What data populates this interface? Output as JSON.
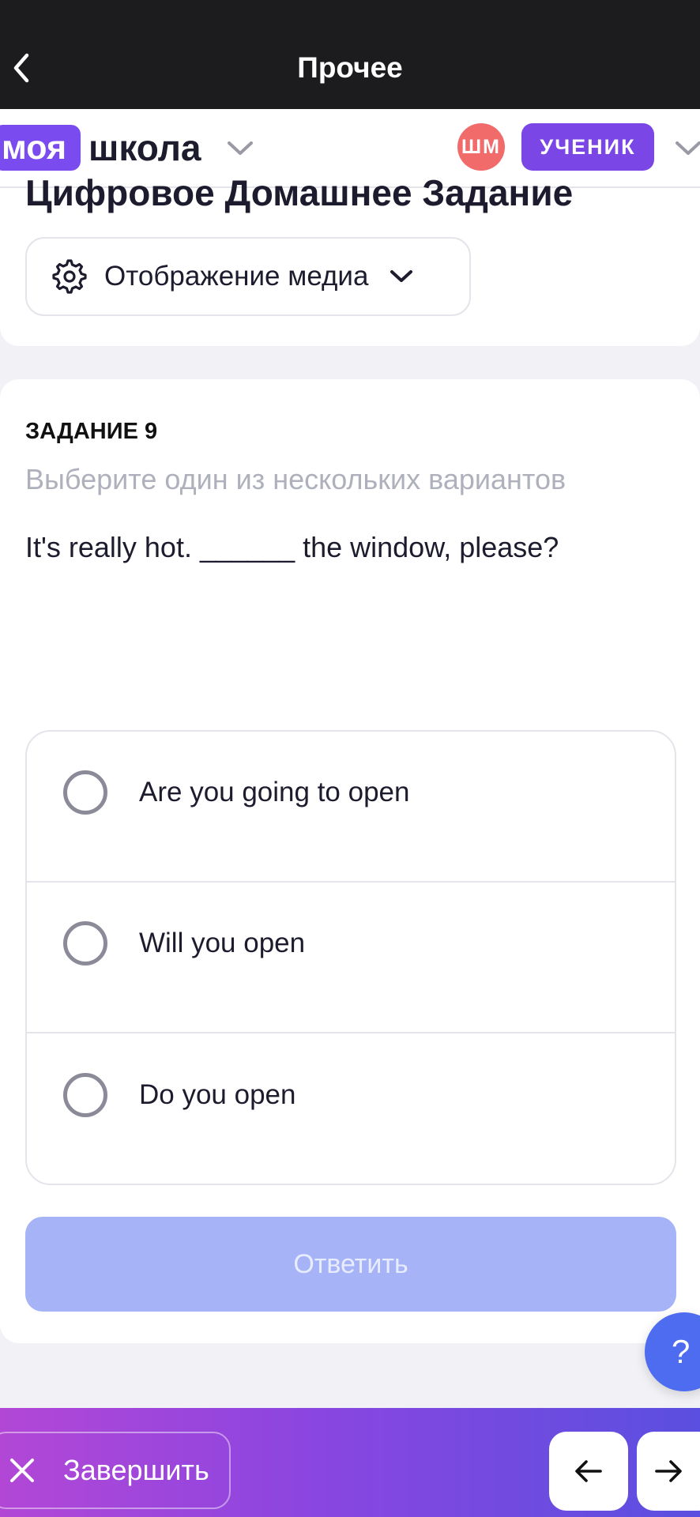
{
  "topbar": {
    "title": "Прочее",
    "back_icon": "chevron-left-icon"
  },
  "school": {
    "brand_highlight": "моя",
    "brand_rest": "школа",
    "avatar_initials": "ШМ",
    "role": "УЧЕНИК"
  },
  "page": {
    "title": "Цифровое Домашнее Задание",
    "media_button_label": "Отображение медиа"
  },
  "task": {
    "number_label": "ЗАДАНИЕ 9",
    "hint": "Выберите один из нескольких вариантов",
    "question": "It's really hot. ______ the window, please?",
    "options": [
      {
        "label": "Are you going to open"
      },
      {
        "label": "Will you open"
      },
      {
        "label": "Do you open"
      }
    ],
    "submit_label": "Ответить"
  },
  "help": {
    "label": "?"
  },
  "bottombar": {
    "finish_label": "Завершить"
  },
  "colors": {
    "brand": "#7a4cf0",
    "avatar": "#f26b6b",
    "submit_disabled": "#a6b3f7",
    "help": "#4d6cf0"
  }
}
